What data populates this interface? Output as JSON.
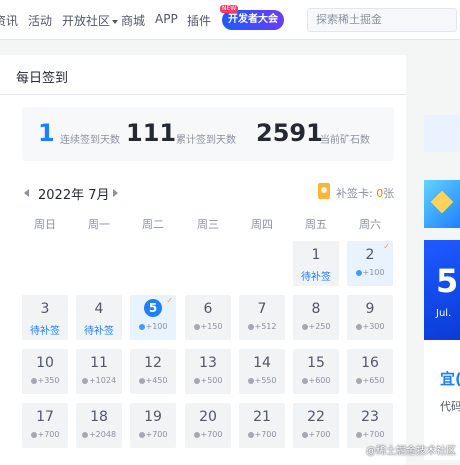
{
  "nav": {
    "items": [
      "资讯",
      "活动",
      "开放社区",
      "商城",
      "APP",
      "插件"
    ],
    "event_label": "开发者大会",
    "event_tag": "NEW",
    "search_placeholder": "探索稀土掘金"
  },
  "signin": {
    "title": "每日签到",
    "stats": [
      {
        "value": "1",
        "label": "连续签到天数",
        "color": "#1e80ff"
      },
      {
        "value": "111",
        "label": "累计签到天数",
        "color": "#252933"
      },
      {
        "value": "2591",
        "label": "当前矿石数",
        "color": "#252933"
      }
    ],
    "month": "2022年 7月",
    "makeup_card_label": "补签卡: ",
    "makeup_card_count": "0",
    "makeup_card_unit": "张",
    "weekdays": [
      "周日",
      "周一",
      "周二",
      "周三",
      "周四",
      "周五",
      "周六"
    ],
    "days": [
      {
        "day": "1",
        "sub": "待补签"
      },
      {
        "day": "2",
        "pts": "+100",
        "signed": true
      },
      {
        "day": "3",
        "sub": "待补签"
      },
      {
        "day": "4",
        "sub": "待补签"
      },
      {
        "day": "5",
        "pts": "+100",
        "signed": true,
        "today": true
      },
      {
        "day": "6",
        "pts": "+150"
      },
      {
        "day": "7",
        "pts": "+512"
      },
      {
        "day": "8",
        "pts": "+250"
      },
      {
        "day": "9",
        "pts": "+300"
      },
      {
        "day": "10",
        "pts": "+350"
      },
      {
        "day": "11",
        "pts": "+1024"
      },
      {
        "day": "12",
        "pts": "+450"
      },
      {
        "day": "13",
        "pts": "+500"
      },
      {
        "day": "14",
        "pts": "+550"
      },
      {
        "day": "15",
        "pts": "+600"
      },
      {
        "day": "16",
        "pts": "+650"
      },
      {
        "day": "17",
        "pts": "+700"
      },
      {
        "day": "18",
        "pts": "+2048"
      },
      {
        "day": "19",
        "pts": "+700"
      },
      {
        "day": "20",
        "pts": "+700"
      },
      {
        "day": "21",
        "pts": "+700"
      },
      {
        "day": "22",
        "pts": "+700"
      },
      {
        "day": "23",
        "pts": "+700"
      }
    ]
  },
  "side": {
    "promo_number": "5",
    "promo_month": "Jul.",
    "yi_label": "宜(",
    "code_label": "代码"
  },
  "watermark": "@稀土掘金技术社区"
}
